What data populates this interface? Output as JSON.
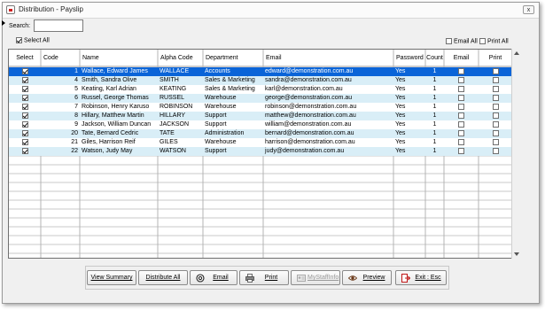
{
  "window": {
    "title": "Distribution - Payslip",
    "close_label": "x"
  },
  "search": {
    "label": "Search:",
    "value": ""
  },
  "select_all": {
    "label": "Select All",
    "checked": true
  },
  "email_all": {
    "label": "Email All",
    "checked": false
  },
  "print_all": {
    "label": "Print All",
    "checked": false
  },
  "table": {
    "columns": [
      "Select",
      "Code",
      "Name",
      "Alpha Code",
      "Department",
      "Email",
      "Password",
      "Count",
      "Email",
      "Print"
    ],
    "rows": [
      {
        "code": "1",
        "name": "Wallace, Edward James",
        "alpha": "WALLACE",
        "department": "Accounts",
        "email": "edward@demonstration.com.au",
        "password": "Yes",
        "count": "1",
        "selected": true
      },
      {
        "code": "4",
        "name": "Smith, Sandra  Olive",
        "alpha": "SMITH",
        "department": "Sales & Marketing",
        "email": "sandra@demonstration.com.au",
        "password": "Yes",
        "count": "1",
        "selected": true
      },
      {
        "code": "5",
        "name": "Keating, Karl Adrian",
        "alpha": "KEATING",
        "department": "Sales & Marketing",
        "email": "karl@demonstration.com.au",
        "password": "Yes",
        "count": "1",
        "selected": true
      },
      {
        "code": "6",
        "name": "Russel, George Thomas",
        "alpha": "RUSSEL",
        "department": "Warehouse",
        "email": "george@demonstration.com.au",
        "password": "Yes",
        "count": "1",
        "selected": true
      },
      {
        "code": "7",
        "name": "Robinson, Henry Karuso",
        "alpha": "ROBINSON",
        "department": "Warehouse",
        "email": "robinson@demonstration.com.au",
        "password": "Yes",
        "count": "1",
        "selected": true
      },
      {
        "code": "8",
        "name": "Hillary, Matthew  Martin",
        "alpha": "HILLARY",
        "department": "Support",
        "email": "matthew@demonstration.com.au",
        "password": "Yes",
        "count": "1",
        "selected": true
      },
      {
        "code": "9",
        "name": "Jackson, William Duncan",
        "alpha": "JACKSON",
        "department": "Support",
        "email": "william@demonstration.com.au",
        "password": "Yes",
        "count": "1",
        "selected": true
      },
      {
        "code": "20",
        "name": "Tate, Bernard Cedric",
        "alpha": "TATE",
        "department": "Administration",
        "email": "bernard@demonstration.com.au",
        "password": "Yes",
        "count": "1",
        "selected": true
      },
      {
        "code": "21",
        "name": "Giles, Harrison  Reif",
        "alpha": "GILES",
        "department": "Warehouse",
        "email": "harrison@demonstration.com.au",
        "password": "Yes",
        "count": "1",
        "selected": true
      },
      {
        "code": "22",
        "name": "Watson, Judy May",
        "alpha": "WATSON",
        "department": "Support",
        "email": "judy@demonstration.com.au",
        "password": "Yes",
        "count": "1",
        "selected": true
      }
    ]
  },
  "buttons": {
    "view_summary": "View Summary",
    "distribute_all": "Distribute All",
    "email": "Email",
    "print": "Print",
    "mystaffinfo": "MyStaffInfo",
    "preview": "Preview",
    "exit": "Exit : Esc"
  },
  "icons": {
    "email": "at-icon",
    "print": "printer-icon",
    "mystaffinfo": "id-card-icon",
    "preview": "eye-icon",
    "exit": "exit-icon"
  },
  "colors": {
    "selected_row": "#0a64d8",
    "alt_row": "#d9eef7",
    "row": "#ffffff"
  }
}
